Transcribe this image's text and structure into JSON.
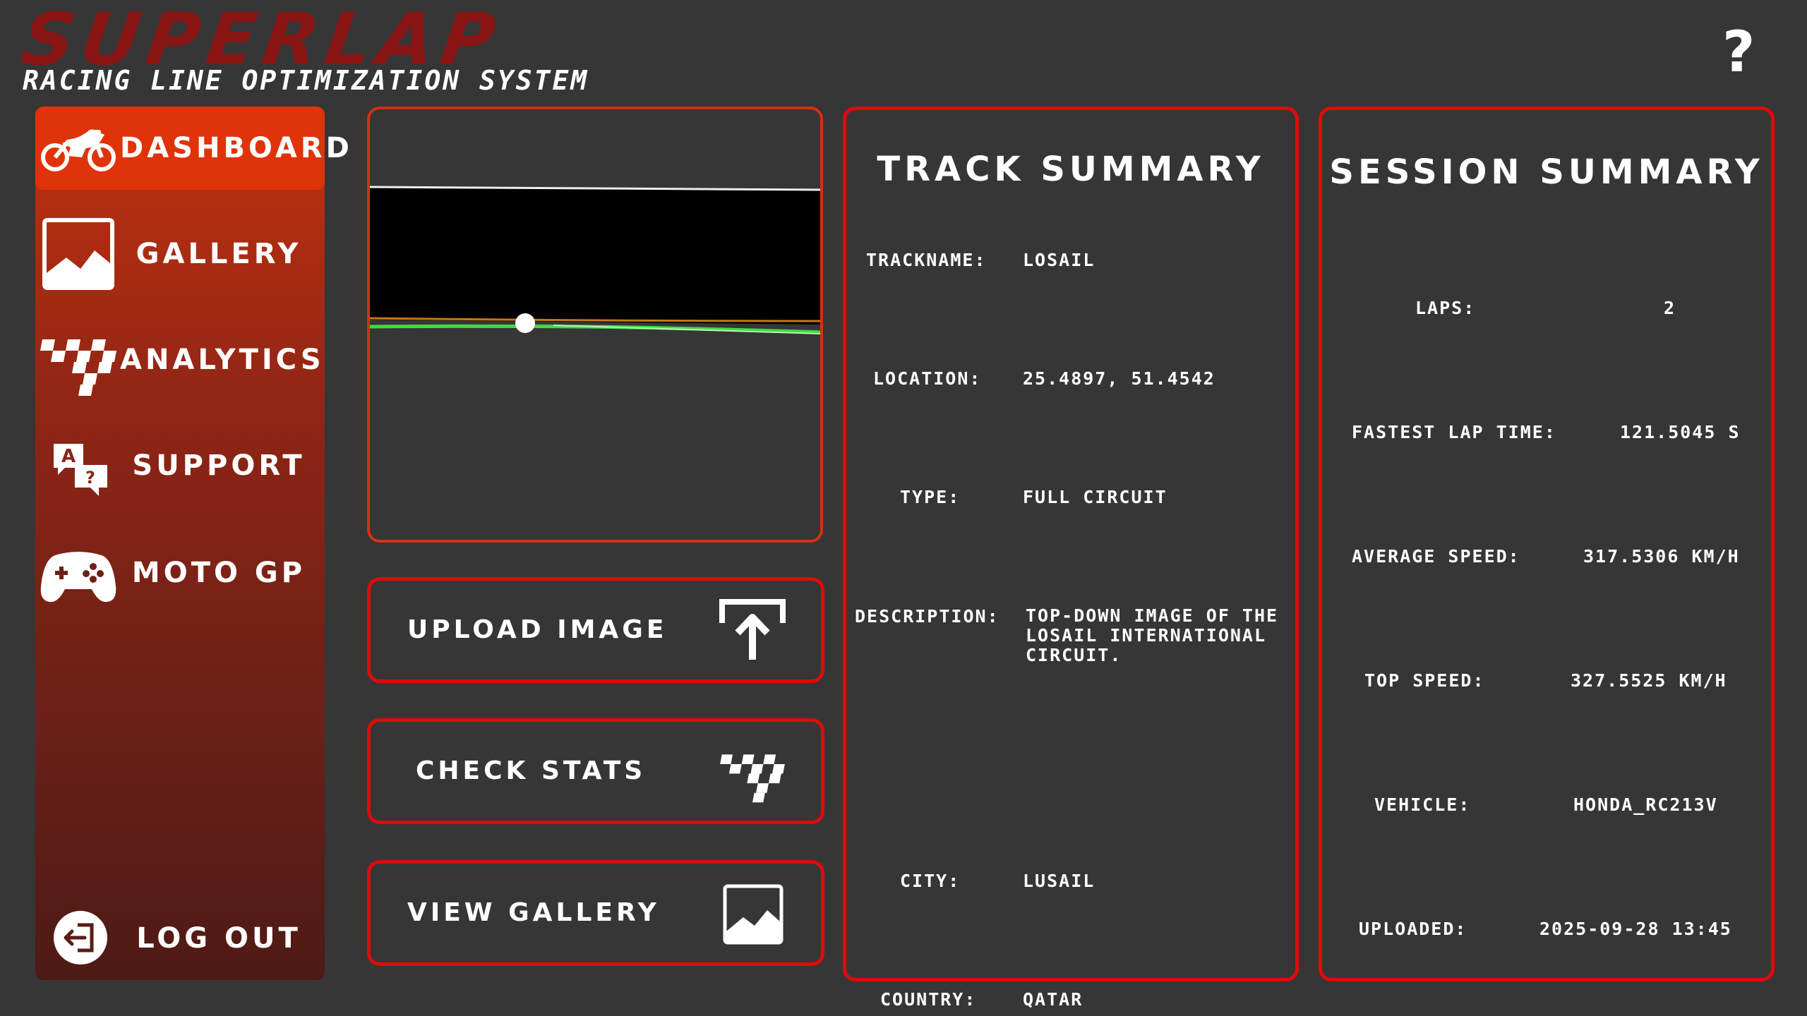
{
  "app": {
    "logo": "SUPERLAP",
    "tagline": "RACING LINE OPTIMIZATION SYSTEM",
    "help": "?"
  },
  "sidebar": {
    "items": [
      {
        "label": "DASHBOARD",
        "icon": "motorcycle-icon",
        "active": true
      },
      {
        "label": "GALLERY",
        "icon": "image-icon"
      },
      {
        "label": "ANALYTICS",
        "icon": "checkered-flag-icon"
      },
      {
        "label": "SUPPORT",
        "icon": "translate-icon"
      },
      {
        "label": "MOTO GP",
        "icon": "gamepad-icon"
      }
    ],
    "logout": {
      "label": "LOG OUT",
      "icon": "logout-icon"
    }
  },
  "actions": {
    "upload": {
      "label": "UPLOAD IMAGE",
      "icon": "upload-icon"
    },
    "stats": {
      "label": "CHECK STATS",
      "icon": "checkered-flag-icon"
    },
    "gallery": {
      "label": "VIEW GALLERY",
      "icon": "image-icon"
    }
  },
  "track": {
    "title": "TRACK SUMMARY",
    "rows": [
      {
        "key": "TRACKNAME:",
        "value": "LOSAIL"
      },
      {
        "key": "LOCATION:",
        "value": "25.4897, 51.4542"
      },
      {
        "key": "TYPE:",
        "value": "FULL CIRCUIT"
      },
      {
        "key": "DESCRIPTION:",
        "value": "TOP-DOWN IMAGE OF THE LOSAIL INTERNATIONAL CIRCUIT."
      },
      {
        "key": "CITY:",
        "value": "LUSAIL"
      },
      {
        "key": "COUNTRY:",
        "value": "QATAR"
      }
    ]
  },
  "session": {
    "title": "SESSION SUMMARY",
    "rows": [
      {
        "key": "LAPS:",
        "value": "2"
      },
      {
        "key": "FASTEST LAP TIME:",
        "value": "121.5045 S"
      },
      {
        "key": "AVERAGE SPEED:",
        "value": "317.5306 KM/H"
      },
      {
        "key": "TOP SPEED:",
        "value": "327.5525 KM/H"
      },
      {
        "key": "VEHICLE:",
        "value": "HONDA_RC213V"
      },
      {
        "key": "UPLOADED:",
        "value": "2025-09-28 13:45"
      }
    ]
  },
  "colors": {
    "background": "#363636",
    "accent_red": "#e00a0a",
    "active_nav": "#e0330a",
    "logo_red": "#8a1515",
    "racing_line": "#3fdc3f"
  }
}
